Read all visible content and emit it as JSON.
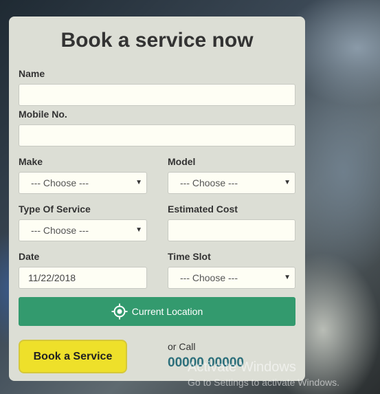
{
  "form": {
    "title": "Book a service now",
    "name_label": "Name",
    "name_value": "",
    "mobile_label": "Mobile No.",
    "mobile_value": "",
    "make_label": "Make",
    "make_selected": "--- Choose ---",
    "model_label": "Model",
    "model_selected": "--- Choose ---",
    "service_type_label": "Type Of Service",
    "service_type_selected": "--- Choose ---",
    "estimated_cost_label": "Estimated Cost",
    "estimated_cost_value": "",
    "date_label": "Date",
    "date_value": "11/22/2018",
    "time_slot_label": "Time Slot",
    "time_slot_selected": "--- Choose ---",
    "location_button": {
      "label": "Current Location",
      "icon": "crosshair-icon"
    },
    "book_button": "Book a Service",
    "or_call": "or Call",
    "phone": "00000 00000"
  },
  "watermark": {
    "title": "Activate Windows",
    "subtitle": "Go to Settings to activate Windows."
  },
  "colors": {
    "card_bg": "#dcded5",
    "input_bg": "#fefef4",
    "location_button_bg": "#339a6e",
    "book_button_bg": "#eee02a",
    "phone_color": "#2c6f7b"
  }
}
